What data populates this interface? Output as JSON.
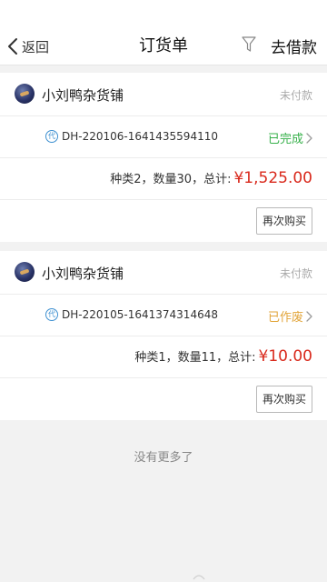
{
  "header": {
    "back_label": "返回",
    "title": "订货单",
    "borrow_label": "去借款"
  },
  "orders": [
    {
      "shop_name": "小刘鸭杂货铺",
      "payment_status": "未付款",
      "code_badge": "代",
      "order_code": "DH-220106-1641435594110",
      "status": "已完成",
      "status_color": "#36b04a",
      "summary": "种类2，数量30，总计:",
      "total": "¥1,525.00",
      "action_label": "再次购买"
    },
    {
      "shop_name": "小刘鸭杂货铺",
      "payment_status": "未付款",
      "code_badge": "代",
      "order_code": "DH-220105-1641374314648",
      "status": "已作废",
      "status_color": "#e2a53a",
      "summary": "种类1，数量11，总计:",
      "total": "¥10.00",
      "action_label": "再次购买"
    }
  ],
  "footer": {
    "no_more_text": "没有更多了"
  },
  "colors": {
    "accent_red": "#d9291c",
    "background": "#f2f2f2"
  }
}
